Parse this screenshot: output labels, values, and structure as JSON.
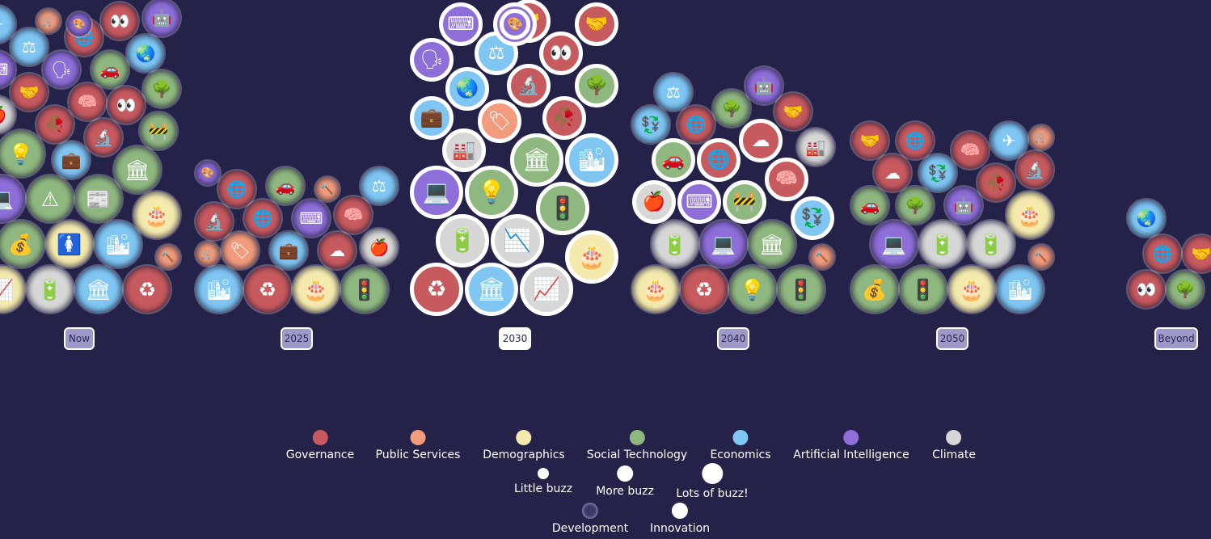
{
  "chart_data": {
    "type": "bubble-timeline",
    "x_ticks": [
      {
        "label": "Now",
        "active": false
      },
      {
        "label": "2025",
        "active": false
      },
      {
        "label": "2030",
        "active": true
      },
      {
        "label": "2040",
        "active": false
      },
      {
        "label": "2050",
        "active": false
      },
      {
        "label": "Beyond",
        "active": false
      }
    ],
    "categories": [
      {
        "key": "gov",
        "label": "Governance",
        "color": "#c65a5e"
      },
      {
        "key": "pub",
        "label": "Public Services",
        "color": "#f29c7d"
      },
      {
        "key": "dem",
        "label": "Demographics",
        "color": "#f4eaae"
      },
      {
        "key": "soc",
        "label": "Social Technology",
        "color": "#8fb780"
      },
      {
        "key": "eco",
        "label": "Economics",
        "color": "#7fc6f3"
      },
      {
        "key": "ai",
        "label": "Artificial Intelligence",
        "color": "#8e6ed8"
      },
      {
        "key": "cli",
        "label": "Climate",
        "color": "#d7d7d7"
      }
    ],
    "buzz_levels": [
      {
        "label": "Little buzz"
      },
      {
        "label": "More buzz"
      },
      {
        "label": "Lots of buzz!"
      }
    ],
    "types": [
      {
        "label": "Development",
        "kind": "development"
      },
      {
        "label": "Innovation",
        "kind": "innovation"
      }
    ],
    "bubbles": [
      {
        "period": 0,
        "cat": "pub",
        "buzz": 1,
        "kind": "dev",
        "icon": "🔨"
      },
      {
        "period": 0,
        "cat": "pub",
        "buzz": 1,
        "kind": "dev",
        "icon": "🛒"
      },
      {
        "period": 0,
        "cat": "eco",
        "buzz": 2,
        "kind": "dev",
        "icon": "💼"
      },
      {
        "period": 0,
        "cat": "ai",
        "buzz": 1,
        "kind": "dev",
        "icon": "🎨"
      },
      {
        "period": 0,
        "cat": "gov",
        "buzz": 2,
        "kind": "dev",
        "icon": "🔬"
      },
      {
        "period": 0,
        "cat": "soc",
        "buzz": 2,
        "kind": "dev",
        "icon": "🚧"
      },
      {
        "period": 0,
        "cat": "gov",
        "buzz": 2,
        "kind": "dev",
        "icon": "🥀"
      },
      {
        "period": 0,
        "cat": "cli",
        "buzz": 2,
        "kind": "dev",
        "icon": "🍎"
      },
      {
        "period": 0,
        "cat": "gov",
        "buzz": 2,
        "kind": "dev",
        "icon": "👀"
      },
      {
        "period": 0,
        "cat": "gov",
        "buzz": 2,
        "kind": "dev",
        "icon": "🧠"
      },
      {
        "period": 0,
        "cat": "gov",
        "buzz": 2,
        "kind": "dev",
        "icon": "🤝"
      },
      {
        "period": 0,
        "cat": "soc",
        "buzz": 2,
        "kind": "dev",
        "icon": "🌳"
      },
      {
        "period": 0,
        "cat": "ai",
        "buzz": 2,
        "kind": "dev",
        "icon": "⌨"
      },
      {
        "period": 0,
        "cat": "ai",
        "buzz": 2,
        "kind": "dev",
        "icon": "🗣"
      },
      {
        "period": 0,
        "cat": "soc",
        "buzz": 2,
        "kind": "dev",
        "icon": "🚗"
      },
      {
        "period": 0,
        "cat": "dem",
        "buzz": 3,
        "kind": "dev",
        "icon": "📈"
      },
      {
        "period": 0,
        "cat": "eco",
        "buzz": 2,
        "kind": "dev",
        "icon": "🌏"
      },
      {
        "period": 0,
        "cat": "eco",
        "buzz": 2,
        "kind": "dev",
        "icon": "⚖"
      },
      {
        "period": 0,
        "cat": "gov",
        "buzz": 2,
        "kind": "dev",
        "icon": "🌐"
      },
      {
        "period": 0,
        "cat": "cli",
        "buzz": 3,
        "kind": "dev",
        "icon": "🔋"
      },
      {
        "period": 0,
        "cat": "eco",
        "buzz": 3,
        "kind": "dev",
        "icon": "🏛"
      },
      {
        "period": 0,
        "cat": "eco",
        "buzz": 2,
        "kind": "dev",
        "icon": "✈"
      },
      {
        "period": 0,
        "cat": "gov",
        "buzz": 3,
        "kind": "dev",
        "icon": "♻"
      },
      {
        "period": 0,
        "cat": "gov",
        "buzz": 2,
        "kind": "dev",
        "icon": "👀"
      },
      {
        "period": 0,
        "cat": "soc",
        "buzz": 3,
        "kind": "dev",
        "icon": "💰"
      },
      {
        "period": 0,
        "cat": "dem",
        "buzz": 3,
        "kind": "dev",
        "icon": "🚺"
      },
      {
        "period": 0,
        "cat": "eco",
        "buzz": 3,
        "kind": "dev",
        "icon": "🏙"
      },
      {
        "period": 0,
        "cat": "ai",
        "buzz": 2,
        "kind": "dev",
        "icon": "🤖"
      },
      {
        "period": 0,
        "cat": "dem",
        "buzz": 3,
        "kind": "dev",
        "icon": "🎂"
      },
      {
        "period": 0,
        "cat": "ai",
        "buzz": 3,
        "kind": "dev",
        "icon": "💻"
      },
      {
        "period": 0,
        "cat": "soc",
        "buzz": 3,
        "kind": "dev",
        "icon": "⚠"
      },
      {
        "period": 0,
        "cat": "soc",
        "buzz": 3,
        "kind": "dev",
        "icon": "📰"
      },
      {
        "period": 0,
        "cat": "soc",
        "buzz": 3,
        "kind": "dev",
        "icon": "🏛"
      },
      {
        "period": 0,
        "cat": "soc",
        "buzz": 3,
        "kind": "dev",
        "icon": "💡"
      },
      {
        "period": 1,
        "cat": "pub",
        "buzz": 1,
        "kind": "dev",
        "icon": "🛒"
      },
      {
        "period": 1,
        "cat": "pub",
        "buzz": 2,
        "kind": "dev",
        "icon": "🏷"
      },
      {
        "period": 1,
        "cat": "pub",
        "buzz": 1,
        "kind": "dev",
        "icon": "🔨"
      },
      {
        "period": 1,
        "cat": "ai",
        "buzz": 1,
        "kind": "dev",
        "icon": "🎨"
      },
      {
        "period": 1,
        "cat": "eco",
        "buzz": 2,
        "kind": "dev",
        "icon": "💼"
      },
      {
        "period": 1,
        "cat": "gov",
        "buzz": 2,
        "kind": "dev",
        "icon": "☁"
      },
      {
        "period": 1,
        "cat": "cli",
        "buzz": 2,
        "kind": "dev",
        "icon": "🍎"
      },
      {
        "period": 1,
        "cat": "gov",
        "buzz": 2,
        "kind": "dev",
        "icon": "🔬"
      },
      {
        "period": 1,
        "cat": "gov",
        "buzz": 2,
        "kind": "dev",
        "icon": "🌐"
      },
      {
        "period": 1,
        "cat": "ai",
        "buzz": 2,
        "kind": "dev",
        "icon": "⌨"
      },
      {
        "period": 1,
        "cat": "gov",
        "buzz": 2,
        "kind": "dev",
        "icon": "🧠"
      },
      {
        "period": 1,
        "cat": "gov",
        "buzz": 2,
        "kind": "dev",
        "icon": "🌐"
      },
      {
        "period": 1,
        "cat": "soc",
        "buzz": 2,
        "kind": "dev",
        "icon": "🚗"
      },
      {
        "period": 1,
        "cat": "eco",
        "buzz": 2,
        "kind": "dev",
        "icon": "⚖"
      },
      {
        "period": 1,
        "cat": "eco",
        "buzz": 3,
        "kind": "dev",
        "icon": "🏙"
      },
      {
        "period": 1,
        "cat": "gov",
        "buzz": 3,
        "kind": "dev",
        "icon": "♻"
      },
      {
        "period": 1,
        "cat": "dem",
        "buzz": 3,
        "kind": "dev",
        "icon": "🎂"
      },
      {
        "period": 1,
        "cat": "soc",
        "buzz": 3,
        "kind": "dev",
        "icon": "🚦"
      },
      {
        "period": 2,
        "cat": "pub",
        "buzz": 1,
        "kind": "inn",
        "icon": "🔨"
      },
      {
        "period": 2,
        "cat": "cli",
        "buzz": 2,
        "kind": "inn",
        "icon": "🏭"
      },
      {
        "period": 2,
        "cat": "pub",
        "buzz": 1,
        "kind": "inn",
        "icon": "🛒"
      },
      {
        "period": 2,
        "cat": "pub",
        "buzz": 2,
        "kind": "inn",
        "icon": "🏷"
      },
      {
        "period": 2,
        "cat": "eco",
        "buzz": 2,
        "kind": "inn",
        "icon": "💼"
      },
      {
        "period": 2,
        "cat": "gov",
        "buzz": 2,
        "kind": "inn",
        "icon": "🥀"
      },
      {
        "period": 2,
        "cat": "eco",
        "buzz": 2,
        "kind": "inn",
        "icon": "🌏"
      },
      {
        "period": 2,
        "cat": "gov",
        "buzz": 2,
        "kind": "inn",
        "icon": "🔬"
      },
      {
        "period": 2,
        "cat": "ai",
        "buzz": 1,
        "kind": "inn",
        "icon": "🎨"
      },
      {
        "period": 2,
        "cat": "soc",
        "buzz": 2,
        "kind": "inn",
        "icon": "🌳"
      },
      {
        "period": 2,
        "cat": "ai",
        "buzz": 2,
        "kind": "inn",
        "icon": "🗣"
      },
      {
        "period": 2,
        "cat": "eco",
        "buzz": 2,
        "kind": "inn",
        "icon": "⚖"
      },
      {
        "period": 2,
        "cat": "gov",
        "buzz": 2,
        "kind": "inn",
        "icon": "👀"
      },
      {
        "period": 2,
        "cat": "ai",
        "buzz": 2,
        "kind": "inn",
        "icon": "⌨"
      },
      {
        "period": 2,
        "cat": "gov",
        "buzz": 2,
        "kind": "inn",
        "icon": "🤝"
      },
      {
        "period": 2,
        "cat": "gov",
        "buzz": 2,
        "kind": "inn",
        "icon": "🤝"
      },
      {
        "period": 2,
        "cat": "gov",
        "buzz": 3,
        "kind": "inn",
        "icon": "♻"
      },
      {
        "period": 2,
        "cat": "ai",
        "buzz": 2,
        "kind": "inn",
        "icon": "🤖"
      },
      {
        "period": 2,
        "cat": "eco",
        "buzz": 3,
        "kind": "inn",
        "icon": "🏛"
      },
      {
        "period": 2,
        "cat": "cli",
        "buzz": 3,
        "kind": "inn",
        "icon": "📈"
      },
      {
        "period": 2,
        "cat": "dem",
        "buzz": 3,
        "kind": "inn",
        "icon": "🎂"
      },
      {
        "period": 2,
        "cat": "cli",
        "buzz": 3,
        "kind": "inn",
        "icon": "🔋"
      },
      {
        "period": 2,
        "cat": "cli",
        "buzz": 3,
        "kind": "inn",
        "icon": "📉"
      },
      {
        "period": 2,
        "cat": "soc",
        "buzz": 3,
        "kind": "inn",
        "icon": "🚦"
      },
      {
        "period": 2,
        "cat": "ai",
        "buzz": 3,
        "kind": "inn",
        "icon": "💻"
      },
      {
        "period": 2,
        "cat": "soc",
        "buzz": 3,
        "kind": "inn",
        "icon": "💡"
      },
      {
        "period": 2,
        "cat": "soc",
        "buzz": 3,
        "kind": "inn",
        "icon": "🏛"
      },
      {
        "period": 2,
        "cat": "eco",
        "buzz": 3,
        "kind": "inn",
        "icon": "🏙"
      },
      {
        "period": 3,
        "cat": "eco",
        "buzz": 2,
        "kind": "inn",
        "icon": "💱"
      },
      {
        "period": 3,
        "cat": "cli",
        "buzz": 2,
        "kind": "inn",
        "icon": "🍎"
      },
      {
        "period": 3,
        "cat": "ai",
        "buzz": 2,
        "kind": "inn",
        "icon": "⌨"
      },
      {
        "period": 3,
        "cat": "soc",
        "buzz": 2,
        "kind": "inn",
        "icon": "🚧"
      },
      {
        "period": 3,
        "cat": "gov",
        "buzz": 2,
        "kind": "inn",
        "icon": "🧠"
      },
      {
        "period": 3,
        "cat": "soc",
        "buzz": 2,
        "kind": "inn",
        "icon": "🚗"
      },
      {
        "period": 3,
        "cat": "gov",
        "buzz": 2,
        "kind": "inn",
        "icon": "🌐"
      },
      {
        "period": 3,
        "cat": "gov",
        "buzz": 2,
        "kind": "inn",
        "icon": "☁"
      },
      {
        "period": 3,
        "cat": "dem",
        "buzz": 3,
        "kind": "dev",
        "icon": "🎂"
      },
      {
        "period": 3,
        "cat": "gov",
        "buzz": 3,
        "kind": "dev",
        "icon": "♻"
      },
      {
        "period": 3,
        "cat": "soc",
        "buzz": 3,
        "kind": "dev",
        "icon": "💡"
      },
      {
        "period": 3,
        "cat": "soc",
        "buzz": 3,
        "kind": "dev",
        "icon": "🚦"
      },
      {
        "period": 3,
        "cat": "pub",
        "buzz": 1,
        "kind": "dev",
        "icon": "🔨"
      },
      {
        "period": 3,
        "cat": "cli",
        "buzz": 2,
        "kind": "dev",
        "icon": "🏭"
      },
      {
        "period": 3,
        "cat": "eco",
        "buzz": 2,
        "kind": "dev",
        "icon": "💱"
      },
      {
        "period": 3,
        "cat": "gov",
        "buzz": 2,
        "kind": "dev",
        "icon": "🌐"
      },
      {
        "period": 3,
        "cat": "gov",
        "buzz": 2,
        "kind": "dev",
        "icon": "🤝"
      },
      {
        "period": 3,
        "cat": "soc",
        "buzz": 2,
        "kind": "dev",
        "icon": "🌳"
      },
      {
        "period": 3,
        "cat": "eco",
        "buzz": 2,
        "kind": "dev",
        "icon": "⚖"
      },
      {
        "period": 3,
        "cat": "ai",
        "buzz": 2,
        "kind": "dev",
        "icon": "🤖"
      },
      {
        "period": 3,
        "cat": "cli",
        "buzz": 3,
        "kind": "dev",
        "icon": "🔋"
      },
      {
        "period": 3,
        "cat": "ai",
        "buzz": 3,
        "kind": "dev",
        "icon": "💻"
      },
      {
        "period": 3,
        "cat": "soc",
        "buzz": 3,
        "kind": "dev",
        "icon": "🏛"
      },
      {
        "period": 4,
        "cat": "soc",
        "buzz": 2,
        "kind": "dev",
        "icon": "🚗"
      },
      {
        "period": 4,
        "cat": "soc",
        "buzz": 3,
        "kind": "dev",
        "icon": "💰"
      },
      {
        "period": 4,
        "cat": "soc",
        "buzz": 2,
        "kind": "dev",
        "icon": "🌳"
      },
      {
        "period": 4,
        "cat": "ai",
        "buzz": 2,
        "kind": "dev",
        "icon": "🤖"
      },
      {
        "period": 4,
        "cat": "soc",
        "buzz": 3,
        "kind": "dev",
        "icon": "🚦"
      },
      {
        "period": 4,
        "cat": "pub",
        "buzz": 1,
        "kind": "dev",
        "icon": "🔨"
      },
      {
        "period": 4,
        "cat": "pub",
        "buzz": 1,
        "kind": "dev",
        "icon": "🛒"
      },
      {
        "period": 4,
        "cat": "gov",
        "buzz": 2,
        "kind": "dev",
        "icon": "🥀"
      },
      {
        "period": 4,
        "cat": "gov",
        "buzz": 2,
        "kind": "dev",
        "icon": "☁"
      },
      {
        "period": 4,
        "cat": "eco",
        "buzz": 2,
        "kind": "dev",
        "icon": "💱"
      },
      {
        "period": 4,
        "cat": "gov",
        "buzz": 2,
        "kind": "dev",
        "icon": "🔬"
      },
      {
        "period": 4,
        "cat": "gov",
        "buzz": 2,
        "kind": "dev",
        "icon": "🧠"
      },
      {
        "period": 4,
        "cat": "gov",
        "buzz": 2,
        "kind": "dev",
        "icon": "🤝"
      },
      {
        "period": 4,
        "cat": "gov",
        "buzz": 2,
        "kind": "dev",
        "icon": "🌐"
      },
      {
        "period": 4,
        "cat": "dem",
        "buzz": 3,
        "kind": "dev",
        "icon": "🎂"
      },
      {
        "period": 4,
        "cat": "eco",
        "buzz": 2,
        "kind": "dev",
        "icon": "✈"
      },
      {
        "period": 4,
        "cat": "eco",
        "buzz": 3,
        "kind": "dev",
        "icon": "🏙"
      },
      {
        "period": 4,
        "cat": "ai",
        "buzz": 3,
        "kind": "dev",
        "icon": "💻"
      },
      {
        "period": 4,
        "cat": "cli",
        "buzz": 3,
        "kind": "dev",
        "icon": "🔋"
      },
      {
        "period": 4,
        "cat": "cli",
        "buzz": 3,
        "kind": "dev",
        "icon": "🔋"
      },
      {
        "period": 4,
        "cat": "dem",
        "buzz": 3,
        "kind": "dev",
        "icon": "🎂"
      },
      {
        "period": 5,
        "cat": "gov",
        "buzz": 2,
        "kind": "dev",
        "icon": "👀"
      },
      {
        "period": 5,
        "cat": "soc",
        "buzz": 2,
        "kind": "dev",
        "icon": "🌳"
      },
      {
        "period": 5,
        "cat": "gov",
        "buzz": 2,
        "kind": "dev",
        "icon": "🌐"
      },
      {
        "period": 5,
        "cat": "gov",
        "buzz": 2,
        "kind": "dev",
        "icon": "🤝"
      },
      {
        "period": 5,
        "cat": "eco",
        "buzz": 2,
        "kind": "dev",
        "icon": "🌏"
      }
    ]
  }
}
